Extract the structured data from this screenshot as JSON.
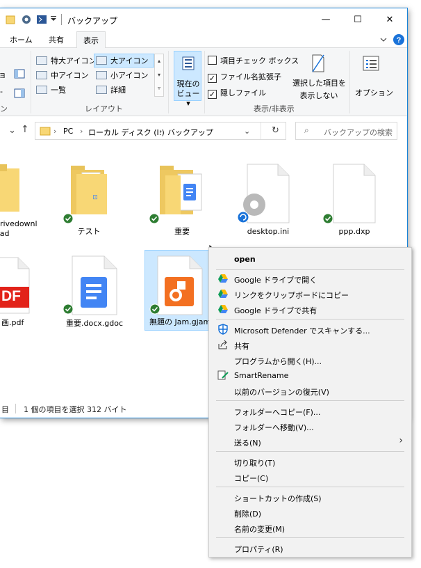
{
  "window": {
    "title": "バックアップ",
    "caption_buttons": [
      "—",
      "☐",
      "✕"
    ]
  },
  "tabs": [
    "ホーム",
    "共有",
    "表示"
  ],
  "ribbon": {
    "layout_items": [
      "特大アイコン",
      "大アイコン",
      "中アイコン",
      "小アイコン",
      "一覧",
      "詳細"
    ],
    "layout_group": "レイアウト",
    "current_view": [
      "現在の",
      "ビュー ▾"
    ],
    "checkboxes": [
      {
        "label": "項目チェック ボックス",
        "checked": false
      },
      {
        "label": "ファイル名拡張子",
        "checked": true
      },
      {
        "label": "隠しファイル",
        "checked": true
      }
    ],
    "hide_selected": [
      "選択した項目を",
      "表示しない"
    ],
    "options": "オプション",
    "showhide_group": "表示/非表示",
    "left_fragment": "ン"
  },
  "address": {
    "path": [
      "PC",
      "ローカル ディスク (I:)",
      "バックアップ"
    ],
    "search_placeholder": "バックアップの検索"
  },
  "files": [
    {
      "name": "drivedownload",
      "line1": "drivedownl",
      "line2": "oad"
    },
    {
      "name": "テスト"
    },
    {
      "name": "重要"
    },
    {
      "name": "desktop.ini"
    },
    {
      "name": "ppp.dxp"
    },
    {
      "name": "画.pdf",
      "badge": "DF"
    },
    {
      "name": "重要.docx.gdoc"
    },
    {
      "name": "無題の Jam.gjam"
    }
  ],
  "status": {
    "count": "目",
    "selection": "1 個の項目を選択 312 バイト"
  },
  "context_menu": [
    {
      "label": "open",
      "bold": true
    },
    {
      "sep": true
    },
    {
      "label": "Google ドライブで開く",
      "icon": "google-drive-icon"
    },
    {
      "label": "リンクをクリップボードにコピー",
      "icon": "google-drive-icon"
    },
    {
      "label": "Google ドライブで共有",
      "icon": "google-drive-icon"
    },
    {
      "sep": true
    },
    {
      "label": "Microsoft Defender でスキャンする...",
      "icon": "defender-icon"
    },
    {
      "label": "共有",
      "icon": "share-icon"
    },
    {
      "label": "プログラムから開く(H)..."
    },
    {
      "label": "SmartRename",
      "icon": "smartrename-icon"
    },
    {
      "label": "以前のバージョンの復元(V)"
    },
    {
      "sep": true
    },
    {
      "label": "フォルダーへコピー(F)..."
    },
    {
      "label": "フォルダーへ移動(V)..."
    },
    {
      "label": "送る(N)",
      "submenu": true
    },
    {
      "sep": true
    },
    {
      "label": "切り取り(T)"
    },
    {
      "label": "コピー(C)"
    },
    {
      "sep": true
    },
    {
      "label": "ショートカットの作成(S)"
    },
    {
      "label": "削除(D)"
    },
    {
      "label": "名前の変更(M)"
    },
    {
      "sep": true
    },
    {
      "label": "プロパティ(R)"
    }
  ],
  "colors": {
    "accent": "#1883d7",
    "folder": "#f8d775",
    "selection": "#cce8ff",
    "sync_green": "#2e7d32",
    "gdoc_blue": "#4285f4",
    "jam_orange": "#f37021",
    "pdf_red": "#e2231a"
  }
}
